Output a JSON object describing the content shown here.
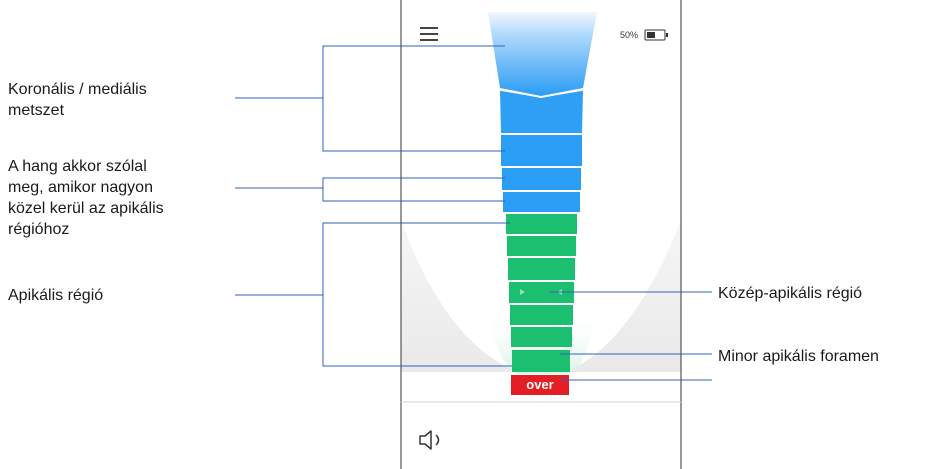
{
  "annotations": {
    "coronal": [
      "Koronális / mediális",
      "metszet"
    ],
    "sound": [
      "A hang akkor szólal",
      "meg, amikor nagyon",
      "közel kerül az apikális",
      "régióhoz"
    ],
    "apical": "Apikális régió",
    "mid_apical": "Közép-apikális régió",
    "minor_foramen": "Minor apikális foramen"
  },
  "device": {
    "battery_text": "50%",
    "battery_level": 0.5,
    "over_label": "over",
    "menu_icon": "hamburger-menu-icon",
    "battery_icon": "battery-icon",
    "speaker_icon": "speaker-icon"
  },
  "colors": {
    "blue_top": "#eaf4fd",
    "blue": "#2a9df4",
    "green": "#1bbf6f",
    "over_red": "#e31e24",
    "line": "#2f63b8"
  }
}
